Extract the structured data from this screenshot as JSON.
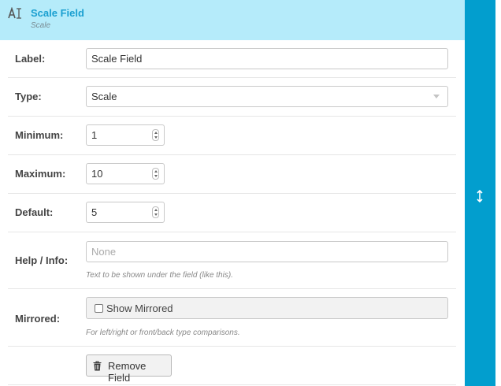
{
  "header": {
    "icon": "text-field-icon",
    "title": "Scale Field",
    "subtitle": "Scale"
  },
  "sidebar": {
    "icon": "resize-vertical-icon",
    "color": "#029ece"
  },
  "form": {
    "label": {
      "label": "Label:",
      "value": "Scale Field"
    },
    "type": {
      "label": "Type:",
      "value": "Scale"
    },
    "minimum": {
      "label": "Minimum:",
      "value": "1"
    },
    "maximum": {
      "label": "Maximum:",
      "value": "10"
    },
    "default": {
      "label": "Default:",
      "value": "5"
    },
    "help_info": {
      "label": "Help / Info:",
      "placeholder": "None",
      "help_text": "Text to be shown under the field (like this)."
    },
    "mirrored": {
      "label": "Mirrored:",
      "checkbox_label": "Show Mirrored",
      "checked": false,
      "help_text": "For left/right or front/back type comparisons."
    },
    "remove_button": {
      "label": "Remove Field",
      "icon": "trash-icon"
    }
  }
}
